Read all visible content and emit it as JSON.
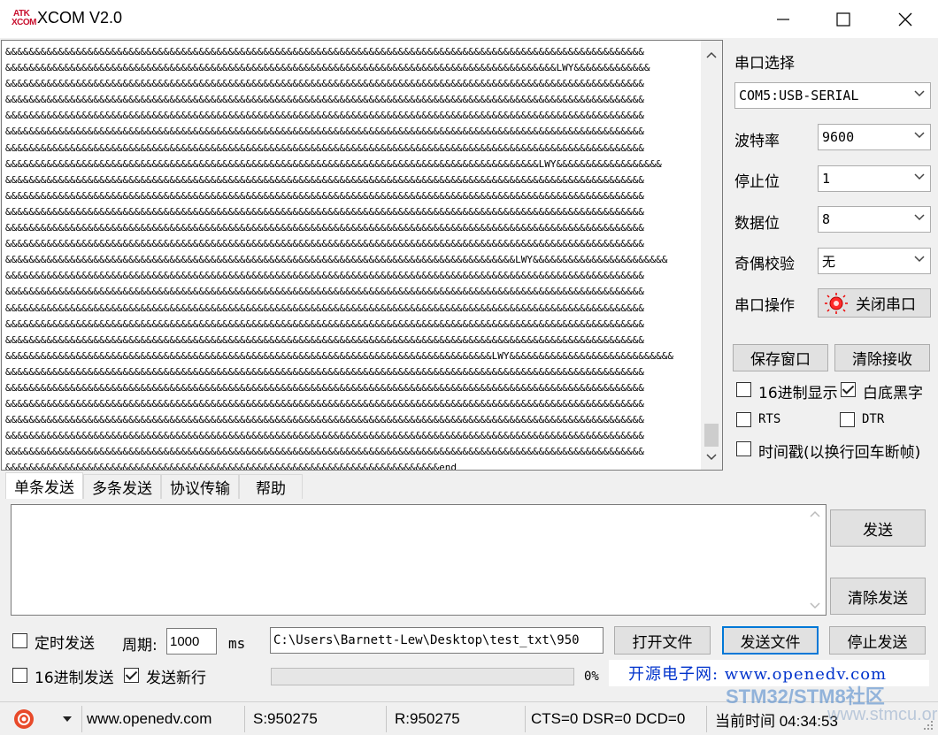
{
  "window": {
    "title": "XCOM V2.0",
    "logo_top": "ATK",
    "logo_bottom": "XCOM"
  },
  "receive": {
    "lines": [
      "&&&&&&&&&&&&&&&&&&&&&&&&&&&&&&&&&&&&&&&&&&&&&&&&&&&&&&&&&&&&&&&&&&&&&&&&&&&&&&&&&&&&&&&&&&&&&&&&&&&&&&&&&&&&&",
      "&&&&&&&&&&&&&&&&&&&&&&&&&&&&&&&&&&&&&&&&&&&&&&&&&&&&&&&&&&&&&&&&&&&&&&&&&&&&&&&&&&&&&&&&&&&&&&LWY&&&&&&&&&&&&&",
      "&&&&&&&&&&&&&&&&&&&&&&&&&&&&&&&&&&&&&&&&&&&&&&&&&&&&&&&&&&&&&&&&&&&&&&&&&&&&&&&&&&&&&&&&&&&&&&&&&&&&&&&&&&&&&",
      "&&&&&&&&&&&&&&&&&&&&&&&&&&&&&&&&&&&&&&&&&&&&&&&&&&&&&&&&&&&&&&&&&&&&&&&&&&&&&&&&&&&&&&&&&&&&&&&&&&&&&&&&&&&&&",
      "&&&&&&&&&&&&&&&&&&&&&&&&&&&&&&&&&&&&&&&&&&&&&&&&&&&&&&&&&&&&&&&&&&&&&&&&&&&&&&&&&&&&&&&&&&&&&&&&&&&&&&&&&&&&&",
      "&&&&&&&&&&&&&&&&&&&&&&&&&&&&&&&&&&&&&&&&&&&&&&&&&&&&&&&&&&&&&&&&&&&&&&&&&&&&&&&&&&&&&&&&&&&&&&&&&&&&&&&&&&&&&",
      "&&&&&&&&&&&&&&&&&&&&&&&&&&&&&&&&&&&&&&&&&&&&&&&&&&&&&&&&&&&&&&&&&&&&&&&&&&&&&&&&&&&&&&&&&&&&&&&&&&&&&&&&&&&&&",
      "&&&&&&&&&&&&&&&&&&&&&&&&&&&&&&&&&&&&&&&&&&&&&&&&&&&&&&&&&&&&&&&&&&&&&&&&&&&&&&&&&&&&&&&&&&&LWY&&&&&&&&&&&&&&&&&&",
      "&&&&&&&&&&&&&&&&&&&&&&&&&&&&&&&&&&&&&&&&&&&&&&&&&&&&&&&&&&&&&&&&&&&&&&&&&&&&&&&&&&&&&&&&&&&&&&&&&&&&&&&&&&&&&",
      "&&&&&&&&&&&&&&&&&&&&&&&&&&&&&&&&&&&&&&&&&&&&&&&&&&&&&&&&&&&&&&&&&&&&&&&&&&&&&&&&&&&&&&&&&&&&&&&&&&&&&&&&&&&&&",
      "&&&&&&&&&&&&&&&&&&&&&&&&&&&&&&&&&&&&&&&&&&&&&&&&&&&&&&&&&&&&&&&&&&&&&&&&&&&&&&&&&&&&&&&&&&&&&&&&&&&&&&&&&&&&&",
      "&&&&&&&&&&&&&&&&&&&&&&&&&&&&&&&&&&&&&&&&&&&&&&&&&&&&&&&&&&&&&&&&&&&&&&&&&&&&&&&&&&&&&&&&&&&&&&&&&&&&&&&&&&&&&",
      "&&&&&&&&&&&&&&&&&&&&&&&&&&&&&&&&&&&&&&&&&&&&&&&&&&&&&&&&&&&&&&&&&&&&&&&&&&&&&&&&&&&&&&&&&&&&&&&&&&&&&&&&&&&&&",
      "&&&&&&&&&&&&&&&&&&&&&&&&&&&&&&&&&&&&&&&&&&&&&&&&&&&&&&&&&&&&&&&&&&&&&&&&&&&&&&&&&&&&&&&LWY&&&&&&&&&&&&&&&&&&&&&&&",
      "&&&&&&&&&&&&&&&&&&&&&&&&&&&&&&&&&&&&&&&&&&&&&&&&&&&&&&&&&&&&&&&&&&&&&&&&&&&&&&&&&&&&&&&&&&&&&&&&&&&&&&&&&&&&&",
      "&&&&&&&&&&&&&&&&&&&&&&&&&&&&&&&&&&&&&&&&&&&&&&&&&&&&&&&&&&&&&&&&&&&&&&&&&&&&&&&&&&&&&&&&&&&&&&&&&&&&&&&&&&&&&",
      "&&&&&&&&&&&&&&&&&&&&&&&&&&&&&&&&&&&&&&&&&&&&&&&&&&&&&&&&&&&&&&&&&&&&&&&&&&&&&&&&&&&&&&&&&&&&&&&&&&&&&&&&&&&&&",
      "&&&&&&&&&&&&&&&&&&&&&&&&&&&&&&&&&&&&&&&&&&&&&&&&&&&&&&&&&&&&&&&&&&&&&&&&&&&&&&&&&&&&&&&&&&&&&&&&&&&&&&&&&&&&&",
      "&&&&&&&&&&&&&&&&&&&&&&&&&&&&&&&&&&&&&&&&&&&&&&&&&&&&&&&&&&&&&&&&&&&&&&&&&&&&&&&&&&&&&&&&&&&&&&&&&&&&&&&&&&&&&",
      "&&&&&&&&&&&&&&&&&&&&&&&&&&&&&&&&&&&&&&&&&&&&&&&&&&&&&&&&&&&&&&&&&&&&&&&&&&&&&&&&&&&LWY&&&&&&&&&&&&&&&&&&&&&&&&&&&&",
      "&&&&&&&&&&&&&&&&&&&&&&&&&&&&&&&&&&&&&&&&&&&&&&&&&&&&&&&&&&&&&&&&&&&&&&&&&&&&&&&&&&&&&&&&&&&&&&&&&&&&&&&&&&&&&",
      "&&&&&&&&&&&&&&&&&&&&&&&&&&&&&&&&&&&&&&&&&&&&&&&&&&&&&&&&&&&&&&&&&&&&&&&&&&&&&&&&&&&&&&&&&&&&&&&&&&&&&&&&&&&&&",
      "&&&&&&&&&&&&&&&&&&&&&&&&&&&&&&&&&&&&&&&&&&&&&&&&&&&&&&&&&&&&&&&&&&&&&&&&&&&&&&&&&&&&&&&&&&&&&&&&&&&&&&&&&&&&&",
      "&&&&&&&&&&&&&&&&&&&&&&&&&&&&&&&&&&&&&&&&&&&&&&&&&&&&&&&&&&&&&&&&&&&&&&&&&&&&&&&&&&&&&&&&&&&&&&&&&&&&&&&&&&&&&",
      "&&&&&&&&&&&&&&&&&&&&&&&&&&&&&&&&&&&&&&&&&&&&&&&&&&&&&&&&&&&&&&&&&&&&&&&&&&&&&&&&&&&&&&&&&&&&&&&&&&&&&&&&&&&&&",
      "&&&&&&&&&&&&&&&&&&&&&&&&&&&&&&&&&&&&&&&&&&&&&&&&&&&&&&&&&&&&&&&&&&&&&&&&&&&&&&&&&&&&&&&&&&&&&&&&&&&&&&&&&&&&&",
      "&&&&&&&&&&&&&&&&&&&&&&&&&&&&&&&&&&&&&&&&&&&&&&&&&&&&&&&&&&&&&&&&&&&&&&&&&&end"
    ]
  },
  "port": {
    "select_label": "串口选择",
    "port_value": "COM5:USB-SERIAL",
    "baud_label": "波特率",
    "baud_value": "9600",
    "stop_label": "停止位",
    "stop_value": "1",
    "data_label": "数据位",
    "data_value": "8",
    "parity_label": "奇偶校验",
    "parity_value": "无",
    "op_label": "串口操作",
    "op_button": "关闭串口"
  },
  "right_actions": {
    "save_window": "保存窗口",
    "clear_receive": "清除接收",
    "hex_display": "16进制显示",
    "hex_display_checked": false,
    "white_bg": "白底黑字",
    "white_bg_checked": true,
    "rts": "RTS",
    "rts_checked": false,
    "dtr": "DTR",
    "dtr_checked": false,
    "timestamp": "时间戳(以换行回车断帧)",
    "timestamp_checked": false
  },
  "tabs": [
    {
      "label": "单条发送",
      "active": true
    },
    {
      "label": "多条发送",
      "active": false
    },
    {
      "label": "协议传输",
      "active": false
    },
    {
      "label": "帮助",
      "active": false
    }
  ],
  "send": {
    "text": "",
    "send_button": "发送",
    "clear_send_button": "清除发送"
  },
  "bottom": {
    "timed_send": "定时发送",
    "timed_send_checked": false,
    "period_label": "周期:",
    "period_value": "1000",
    "period_unit": "ms",
    "file_path": "C:\\Users\\Barnett-Lew\\Desktop\\test_txt\\950",
    "open_file": "打开文件",
    "send_file": "发送文件",
    "stop_send": "停止发送",
    "hex_send": "16进制发送",
    "hex_send_checked": false,
    "send_newline": "发送新行",
    "send_newline_checked": true,
    "progress_percent": 0,
    "progress_text": "0%",
    "ad_text": "开源电子网: www.openedv.com"
  },
  "statusbar": {
    "website": "www.openedv.com",
    "sent": "S:950275",
    "received": "R:950275",
    "signals": "CTS=0 DSR=0 DCD=0",
    "time": "当前时间 04:34:53"
  },
  "watermark": {
    "line1": "STM32/STM8社区",
    "line2": "www.stmcu.org"
  },
  "colors": {
    "accent": "#0078d7",
    "ad_blue": "#0033cc",
    "progress_green": "#06b025",
    "logo_red": "#c8102e"
  }
}
